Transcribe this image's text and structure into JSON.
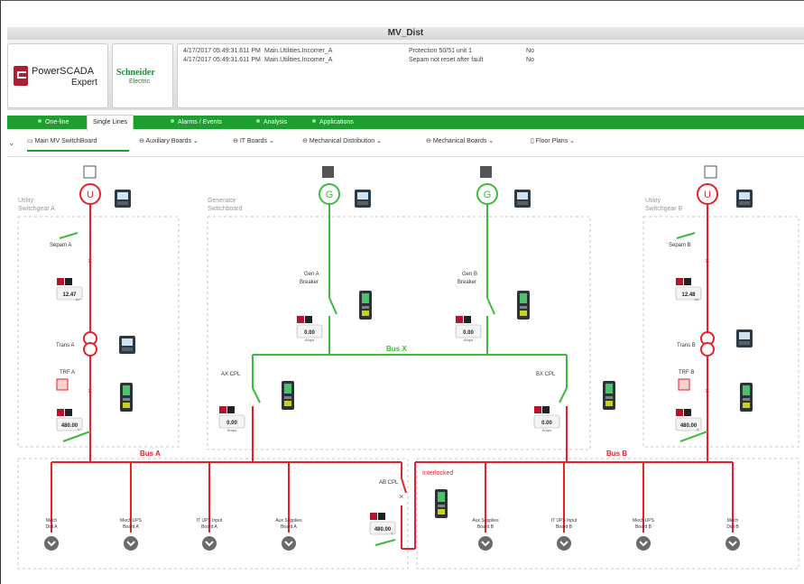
{
  "window": {
    "title": "MV_Dist"
  },
  "logos": {
    "powerscada": {
      "line1": "PowerSCADA",
      "line2": "Expert"
    },
    "schneider": {
      "line1": "Schneider",
      "line2": "Electric"
    }
  },
  "alarms": [
    {
      "timestamp": "4/17/2017  05:49:31.611 PM",
      "tag": "Main.Utilities.Incomer_A",
      "message": "Protection 50/51 unit 1",
      "ack": "No"
    },
    {
      "timestamp": "4/17/2017  05:49:31.611 PM",
      "tag": "Main.Utilities.Incomer_A",
      "message": "Sepam not reset after fault",
      "ack": "No"
    }
  ],
  "tabs": {
    "one_line": "One-line",
    "single_lines": "Single Lines",
    "alarms_events": "Alarms / Events",
    "analysis": "Analysis",
    "applications": "Applications"
  },
  "nav": {
    "main_mv": "Main MV SwitchBoard",
    "auxiliary": "Auxiliary Boards",
    "it_boards": "IT Boards",
    "mechanical_distribution": "Mechanical Distribution",
    "mechanical_boards": "Mechanical Boards",
    "floor_plans": "Floor Plans"
  },
  "colors": {
    "accent_green": "#1e9e2e",
    "energized_red": "#e8202a",
    "generator_green": "#3cbc3c"
  },
  "diagram": {
    "utility_a": {
      "title1": "Utility",
      "title2": "Switchgear A",
      "source": "U",
      "sepam": "Sepam A",
      "voltage": "12.47",
      "voltage_unit": "kV",
      "trans": "Trans A",
      "trf": "TRF A",
      "voltage2": "480.00",
      "voltage2_unit": "V"
    },
    "utility_b": {
      "title1": "Utility",
      "title2": "Switchgear B",
      "source": "U",
      "sepam": "Sepam B",
      "voltage": "12.48",
      "voltage_unit": "kV",
      "trans": "Trans B",
      "trf": "TRF B",
      "voltage2": "480.00",
      "voltage2_unit": "V"
    },
    "generator": {
      "title1": "Generator",
      "title2": "Switchboard",
      "source": "G",
      "gen_a": "Gen A",
      "gen_b": "Gen B",
      "breaker": "Breaker",
      "amps_a": "0.00",
      "amps_b": "0.00",
      "amps_unit": "Amps",
      "bus_x": "Bus X",
      "ax_cpl": "AX CPL",
      "bx_cpl": "BX CPL",
      "ax_amps": "0.00",
      "bx_amps": "0.00"
    },
    "bus_a": "Bus A",
    "bus_b": "Bus B",
    "ab_cpl": "AB CPL",
    "interlocked": "Interlocked",
    "ab_voltage": "480.00",
    "ab_voltage_unit": "V",
    "feeders": [
      {
        "line1": "Mech",
        "line2": "Dist A"
      },
      {
        "line1": "Mech UPS",
        "line2": "Board A"
      },
      {
        "line1": "IT UPS Input",
        "line2": "Board A"
      },
      {
        "line1": "Aux Supplies",
        "line2": "Board A"
      },
      {
        "line1": "Aux Supplies",
        "line2": "Board B"
      },
      {
        "line1": "IT UPS Input",
        "line2": "Board B"
      },
      {
        "line1": "Mech UPS",
        "line2": "Board B"
      },
      {
        "line1": "Mech",
        "line2": "Dist B"
      }
    ]
  }
}
